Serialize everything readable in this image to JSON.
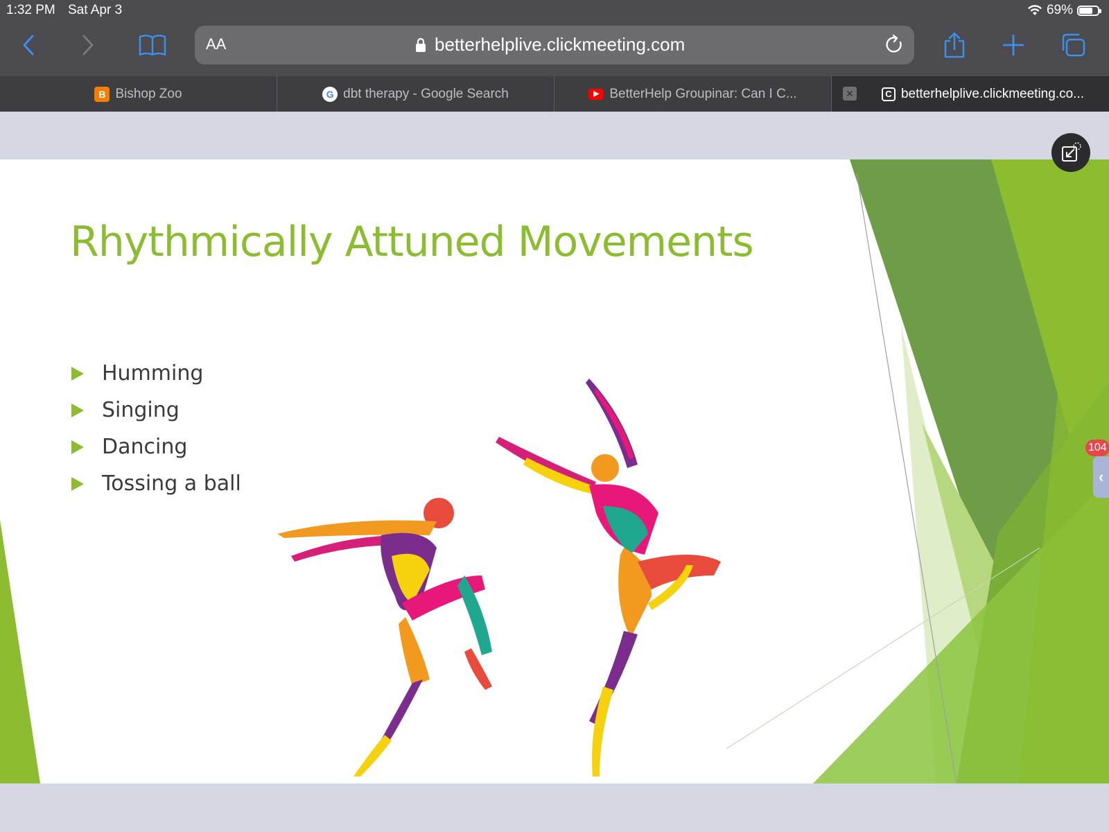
{
  "status_bar": {
    "time": "1:32 PM",
    "date": "Sat Apr 3",
    "battery": "69%",
    "battery_level": 0.69
  },
  "toolbar": {
    "reader_label": "AA",
    "url": "betterhelplive.clickmeeting.com"
  },
  "tabs": [
    {
      "title": "Bishop Zoo",
      "favicon": "blogger-icon",
      "color": "#f57d00",
      "active": false
    },
    {
      "title": "dbt therapy - Google Search",
      "favicon": "google-icon",
      "color": "#4285f4",
      "active": false
    },
    {
      "title": "BetterHelp Groupinar: Can I C...",
      "favicon": "youtube-icon",
      "color": "#ff0000",
      "active": false
    },
    {
      "title": "betterhelplive.clickmeeting.co...",
      "favicon": "c-icon",
      "color": "#ffffff",
      "active": true
    }
  ],
  "slide": {
    "title": "Rhythmically Attuned Movements",
    "bullets": [
      "Humming",
      "Singing",
      "Dancing",
      "Tossing a ball"
    ],
    "accent_color": "#8cbc2f",
    "image": "dancers-illustration"
  },
  "side_panel": {
    "badge": "104"
  }
}
